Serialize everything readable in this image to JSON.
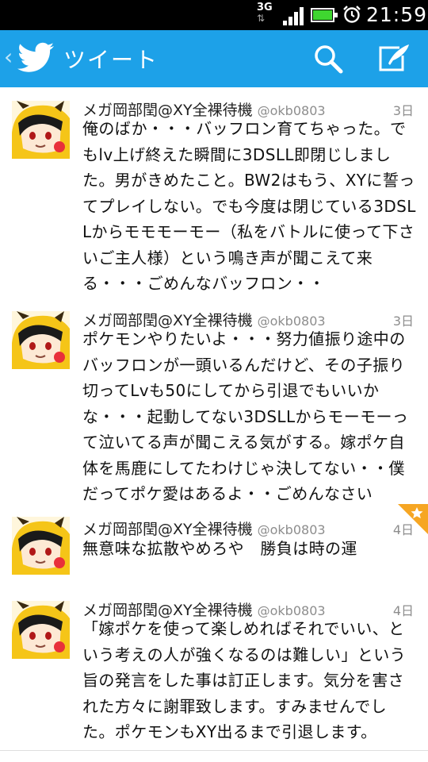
{
  "status_bar": {
    "network": "3G",
    "time": "21:59",
    "battery_color": "#3fd630"
  },
  "action_bar": {
    "title": "ツイート",
    "background": "#1da1e8"
  },
  "tweets": [
    {
      "name": "メガ岡部閏@XY全裸待機",
      "handle": "@okb0803",
      "time": "3日",
      "text": "俺のばか・・・バッフロン育てちゃった。でもlv上げ終えた瞬間に3DSLL即閉じしました。男がきめたこと。BW2はもう、XYに誓ってプレイしない。でも今度は閉じている3DSLLからモモモーモー（私をバトルに使って下さいご主人様）という鳴き声が聞こえて来る・・・ごめんなバッフロン・・"
    },
    {
      "name": "メガ岡部閏@XY全裸待機",
      "handle": "@okb0803",
      "time": "3日",
      "text": "ポケモンやりたいよ・・・努力値振り途中のバッフロンが一頭いるんだけど、その子振り切ってLvも50にしてから引退でもいいかな・・・起動してない3DSLLからモーモーって泣いてる声が聞こえる気がする。嫁ポケ自体を馬鹿にしてたわけじゃ決してない・・僕だってポケ愛はあるよ・・ごめんなさい"
    },
    {
      "name": "メガ岡部閏@XY全裸待機",
      "handle": "@okb0803",
      "time": "4日",
      "text": "無意味な拡散やめろや　勝負は時の運",
      "favorited": true
    },
    {
      "name": "メガ岡部閏@XY全裸待機",
      "handle": "@okb0803",
      "time": "4日",
      "text": "「嫁ポケを使って楽しめればそれでいい、という考えの人が強くなるのは難しい」という旨の発言をした事は訂正します。気分を害された方々に謝罪致します。すみませんでした。ポケモンもXY出るまで引退します。"
    }
  ]
}
